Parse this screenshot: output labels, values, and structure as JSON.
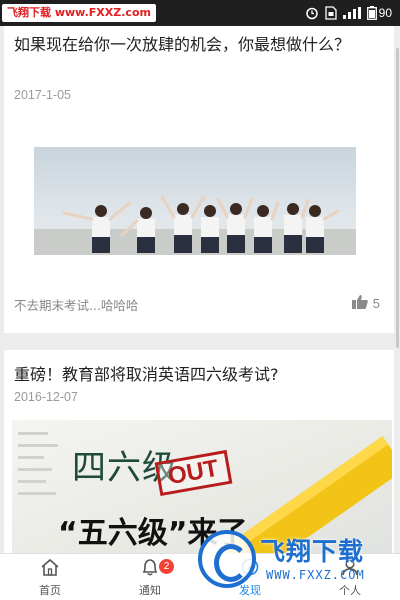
{
  "status_bar": {
    "watermark": "飞翔下载 www.FXXZ.com",
    "battery_level": "90"
  },
  "feed": [
    {
      "title": "如果现在给你一次放肆的机会，你最想做什么？",
      "date": "2017-1-05",
      "snippet": "不去期末考试...哈哈哈",
      "likes": "5"
    },
    {
      "title": "重磅！教育部将取消英语四六级考试?",
      "date": "2016-12-07",
      "image_text": {
        "headline": "四六级",
        "stamp": "OUT",
        "subline": "“五六级”来了"
      }
    }
  ],
  "nav": {
    "tabs": [
      {
        "label": "首页",
        "icon": "home-icon"
      },
      {
        "label": "通知",
        "icon": "bell-icon",
        "badge": "2"
      },
      {
        "label": "发现",
        "icon": "compass-icon",
        "active": true
      },
      {
        "label": "个人",
        "icon": "person-icon"
      }
    ]
  },
  "watermark_overlay": {
    "title": "飞翔下载",
    "url": "WWW.FXXZ.COM"
  },
  "colors": {
    "accent": "#1e88e5",
    "badge": "#f44336",
    "status_bar": "#1f1f1f",
    "watermark_blue": "#1e6fd0"
  }
}
